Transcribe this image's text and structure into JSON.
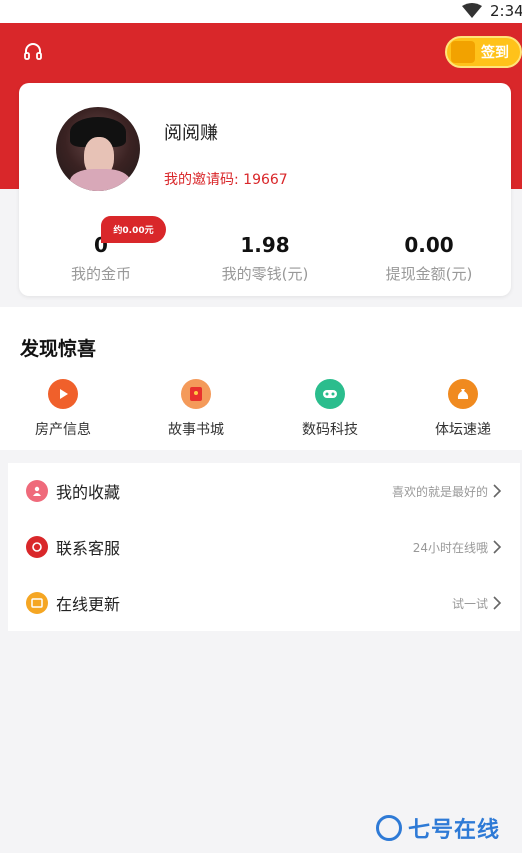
{
  "status_bar": {
    "time": "2:34"
  },
  "header": {
    "signin_label": "签到"
  },
  "profile": {
    "username": "阅阅赚",
    "invite_code": "我的邀请码: 19667",
    "stats": [
      {
        "value": "0",
        "label": "我的金币"
      },
      {
        "value": "1.98",
        "label": "我的零钱(元)"
      },
      {
        "value": "0.00",
        "label": "提现金额(元)"
      }
    ],
    "coin_badge": "约0.00元"
  },
  "discover": {
    "title": "发现惊喜",
    "items": [
      {
        "label": "房产信息",
        "icon": "play-icon",
        "color": "#f0602b"
      },
      {
        "label": "故事书城",
        "icon": "red-envelope-icon",
        "color": "#f49a5a"
      },
      {
        "label": "数码科技",
        "icon": "gamepad-icon",
        "color": "#2bbd8d"
      },
      {
        "label": "体坛速递",
        "icon": "money-bag-icon",
        "color": "#f08a1f"
      }
    ]
  },
  "menu": {
    "items": [
      {
        "label": "我的收藏",
        "hint": "喜欢的就是最好的",
        "icon": "favorite-icon",
        "color": "#ef6a7b"
      },
      {
        "label": "联系客服",
        "hint": "24小时在线哦",
        "icon": "customer-service-icon",
        "color": "#d9272a"
      },
      {
        "label": "在线更新",
        "hint": "试一试",
        "icon": "update-icon",
        "color": "#f5a623"
      }
    ]
  },
  "watermark": {
    "text": "七号在线"
  },
  "colors": {
    "brand_red": "#d9272a",
    "gold": "#ffc21a",
    "watermark_blue": "#2e7ad6"
  }
}
